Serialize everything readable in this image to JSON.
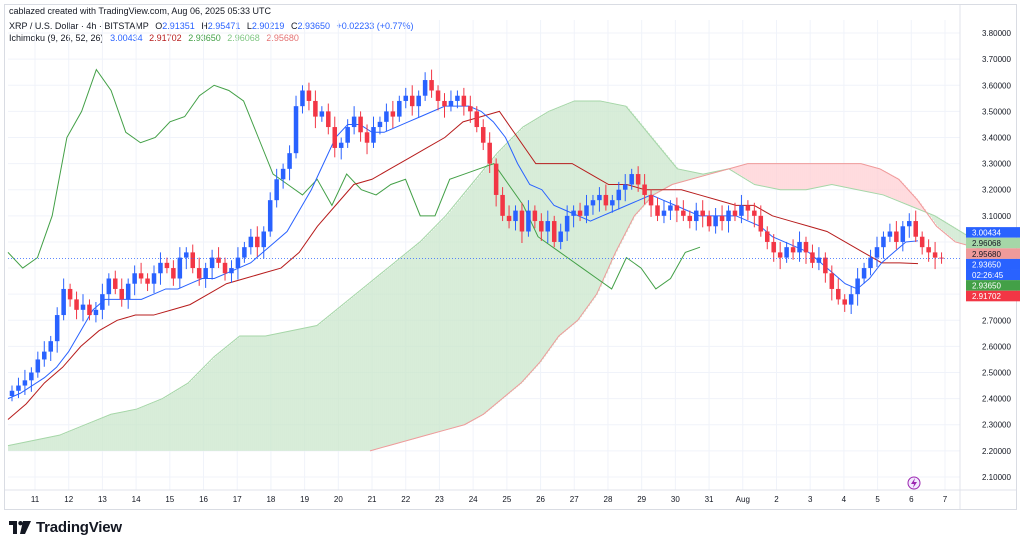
{
  "caption": "cablazed created with TradingView.com, Aug 06, 2025 05:33 UTC",
  "symbol_line": {
    "title": "XRP / U.S. Dollar · 4h · BITSTAMP",
    "open_label": "O",
    "open": "2.91351",
    "high_label": "H",
    "high": "2.95471",
    "low_label": "L",
    "low": "2.90219",
    "close_label": "C",
    "close": "2.93650",
    "change": "+0.02233 (+0.77%)"
  },
  "ichimoku_line": {
    "title": "Ichimoku (9, 26, 52, 26)",
    "v1": "3.00434",
    "v2": "2.91702",
    "v3": "2.93650",
    "v4": "2.96068",
    "v5": "2.95680"
  },
  "footer": {
    "brand": "TradingView"
  },
  "colors": {
    "up": "#2962ff",
    "down": "#f23645",
    "conversion": "#2962ff",
    "base": "#b71c1c",
    "lagging": "#43a047",
    "span_a": "#a5d6a7",
    "span_b": "#ef9a9a",
    "cloud_green": "#c8e6c9",
    "cloud_red": "#ffcdd2",
    "text_green": "#43a047",
    "text_red": "#f23645",
    "text_blue": "#2962ff"
  },
  "chart_data": {
    "type": "candlestick",
    "title": "XRP / U.S. Dollar · 4h · BITSTAMP",
    "ylim": [
      2.05,
      3.85
    ],
    "y_ticks": [
      "2.10000",
      "2.20000",
      "2.30000",
      "2.40000",
      "2.50000",
      "2.60000",
      "2.70000",
      "2.80000",
      "2.90000",
      "3.00000",
      "3.10000",
      "3.20000",
      "3.30000",
      "3.40000",
      "3.50000",
      "3.60000",
      "3.70000",
      "3.80000"
    ],
    "x_ticks": [
      "11",
      "12",
      "13",
      "14",
      "15",
      "16",
      "17",
      "18",
      "19",
      "20",
      "21",
      "22",
      "23",
      "24",
      "25",
      "26",
      "27",
      "28",
      "29",
      "30",
      "31",
      "Aug",
      "2",
      "3",
      "4",
      "5",
      "6",
      "7"
    ],
    "grid": true,
    "price_labels": [
      {
        "text": "3.00434",
        "value": 3.00434,
        "color": "#2962ff"
      },
      {
        "text": "2.96068",
        "value": 2.96068,
        "color": "#a5d6a7"
      },
      {
        "text": "2.95680",
        "value": 2.9568,
        "color": "#ef9a9a"
      },
      {
        "text": "2.93650",
        "value": 2.9365,
        "color": "#2962ff"
      },
      {
        "text": "02:26:45",
        "value": 2.9365,
        "color": "#2962ff"
      },
      {
        "text": "2.93650",
        "value": 2.9365,
        "color": "#43a047"
      },
      {
        "text": "2.91702",
        "value": 2.91702,
        "color": "#f23645"
      }
    ],
    "last_price": 2.9365,
    "candles_close": [
      2.43,
      2.45,
      2.47,
      2.5,
      2.55,
      2.58,
      2.62,
      2.72,
      2.82,
      2.78,
      2.74,
      2.76,
      2.72,
      2.74,
      2.8,
      2.86,
      2.82,
      2.78,
      2.84,
      2.88,
      2.86,
      2.84,
      2.88,
      2.92,
      2.9,
      2.86,
      2.94,
      2.96,
      2.9,
      2.86,
      2.9,
      2.94,
      2.92,
      2.88,
      2.9,
      2.94,
      2.98,
      3.02,
      2.98,
      3.04,
      3.16,
      3.24,
      3.28,
      3.34,
      3.52,
      3.58,
      3.54,
      3.48,
      3.5,
      3.44,
      3.36,
      3.38,
      3.44,
      3.48,
      3.42,
      3.38,
      3.44,
      3.46,
      3.5,
      3.48,
      3.54,
      3.56,
      3.52,
      3.56,
      3.62,
      3.58,
      3.54,
      3.52,
      3.54,
      3.56,
      3.52,
      3.5,
      3.44,
      3.38,
      3.3,
      3.18,
      3.1,
      3.08,
      3.12,
      3.04,
      3.12,
      3.08,
      3.04,
      3.08,
      3.0,
      3.04,
      3.1,
      3.12,
      3.1,
      3.14,
      3.16,
      3.18,
      3.14,
      3.16,
      3.2,
      3.22,
      3.26,
      3.22,
      3.18,
      3.14,
      3.1,
      3.12,
      3.14,
      3.12,
      3.1,
      3.08,
      3.12,
      3.1,
      3.06,
      3.1,
      3.08,
      3.12,
      3.1,
      3.14,
      3.12,
      3.1,
      3.04,
      3.0,
      2.96,
      2.94,
      2.98,
      2.96,
      3.0,
      2.96,
      2.92,
      2.94,
      2.88,
      2.82,
      2.78,
      2.76,
      2.8,
      2.86,
      2.9,
      2.94,
      2.98,
      3.02,
      3.04,
      3.0,
      3.06,
      3.08,
      3.02,
      2.98,
      2.96,
      2.94,
      2.9365
    ],
    "conversion_line": [
      2.4,
      2.42,
      2.45,
      2.48,
      2.52,
      2.58,
      2.66,
      2.74,
      2.78,
      2.78,
      2.78,
      2.78,
      2.8,
      2.82,
      2.82,
      2.84,
      2.86,
      2.86,
      2.88,
      2.9,
      2.92,
      2.96,
      3.0,
      3.04,
      3.12,
      3.2,
      3.3,
      3.4,
      3.45,
      3.45,
      3.42,
      3.42,
      3.44,
      3.46,
      3.48,
      3.5,
      3.52,
      3.52,
      3.52,
      3.5,
      3.46,
      3.4,
      3.3,
      3.22,
      3.2,
      3.14,
      3.12,
      3.1,
      3.08,
      3.1,
      3.12,
      3.14,
      3.16,
      3.18,
      3.16,
      3.14,
      3.12,
      3.1,
      3.1,
      3.1,
      3.1,
      3.08,
      3.06,
      3.02,
      3.0,
      2.98,
      2.96,
      2.92,
      2.88,
      2.84,
      2.82,
      2.86,
      2.92,
      2.96,
      3.0,
      3.00434
    ],
    "base_line": [
      2.32,
      2.38,
      2.46,
      2.52,
      2.6,
      2.66,
      2.7,
      2.72,
      2.72,
      2.74,
      2.76,
      2.8,
      2.84,
      2.86,
      2.88,
      2.9,
      2.96,
      3.06,
      3.14,
      3.22,
      3.24,
      3.28,
      3.32,
      3.36,
      3.4,
      3.46,
      3.48,
      3.5,
      3.4,
      3.3,
      3.3,
      3.3,
      3.26,
      3.22,
      3.22,
      3.2,
      3.2,
      3.2,
      3.18,
      3.16,
      3.14,
      3.14,
      3.1,
      3.08,
      3.06,
      3.04,
      3.0,
      2.96,
      2.92,
      2.92,
      2.91702
    ],
    "lagging_span": [
      2.96,
      2.9,
      2.94,
      3.1,
      3.4,
      3.5,
      3.66,
      3.58,
      3.42,
      3.38,
      3.4,
      3.46,
      3.48,
      3.56,
      3.6,
      3.58,
      3.54,
      3.4,
      3.26,
      3.22,
      3.18,
      3.24,
      3.14,
      3.26,
      3.2,
      3.18,
      3.22,
      3.24,
      3.1,
      3.1,
      3.24,
      3.26,
      3.28,
      3.3,
      3.22,
      3.14,
      3.02,
      2.98,
      2.94,
      2.9,
      2.86,
      2.82,
      2.94,
      2.9,
      2.82,
      2.86,
      2.96,
      2.98
    ],
    "span_a": [
      2.22,
      2.24,
      2.26,
      2.3,
      2.34,
      2.36,
      2.4,
      2.46,
      2.56,
      2.64,
      2.64,
      2.66,
      2.68,
      2.76,
      2.84,
      2.92,
      3.0,
      3.1,
      3.22,
      3.34,
      3.44,
      3.5,
      3.54,
      3.54,
      3.52,
      3.4,
      3.28,
      3.26,
      3.28,
      3.22,
      3.2,
      3.2,
      3.22,
      3.2,
      3.18,
      3.14,
      3.1,
      3.04,
      2.98,
      2.96068
    ],
    "span_b": [
      2.2,
      2.22,
      2.24,
      2.26,
      2.28,
      2.3,
      2.34,
      2.4,
      2.46,
      2.54,
      2.64,
      2.7,
      2.8,
      2.96,
      3.1,
      3.18,
      3.22,
      3.24,
      3.26,
      3.28,
      3.3,
      3.3,
      3.3,
      3.3,
      3.3,
      3.3,
      3.3,
      3.28,
      3.24,
      3.16,
      3.06,
      3.0,
      2.98,
      2.96,
      2.9568
    ]
  }
}
